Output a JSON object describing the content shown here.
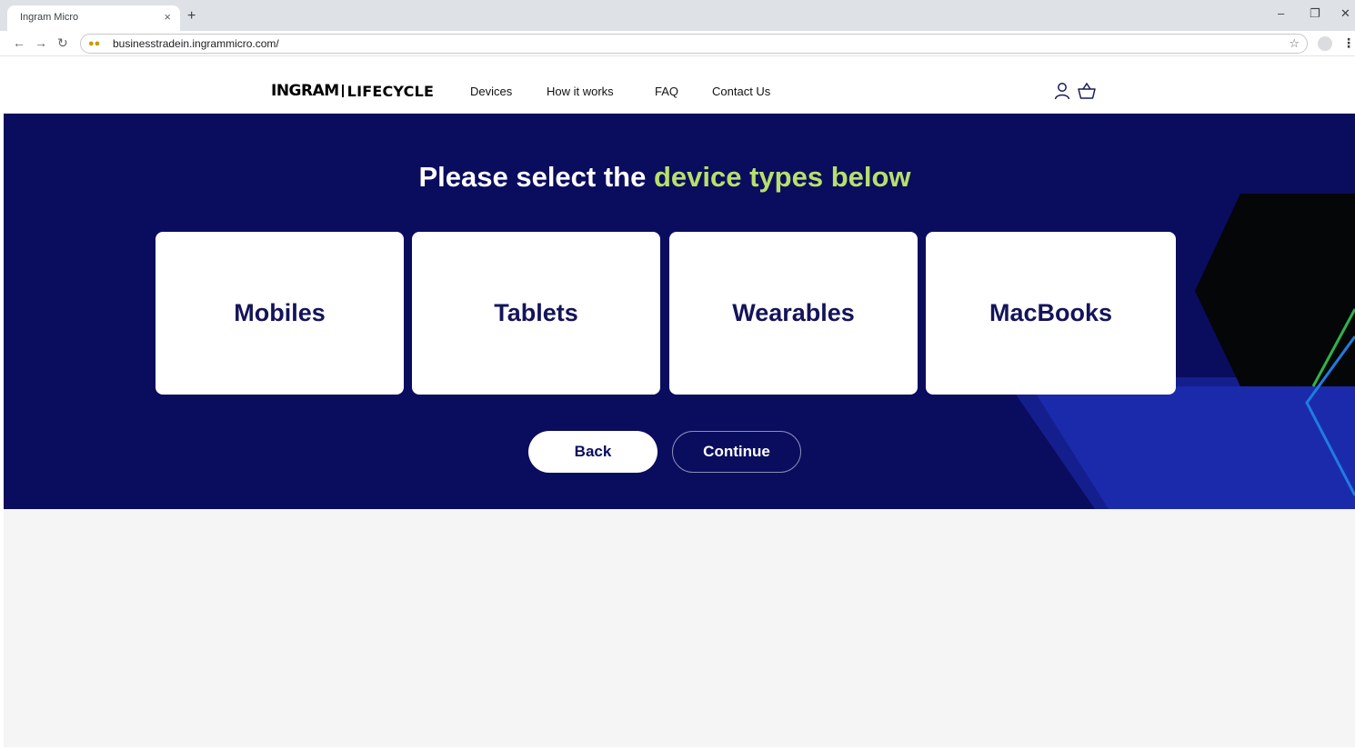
{
  "browser": {
    "tab_title": "Ingram Micro",
    "tab_close": "×",
    "new_tab": "+",
    "url": "businesstradein.ingrammicro.com/",
    "controls": {
      "minimize": "–",
      "restore": "❐",
      "close": "✕"
    }
  },
  "header": {
    "logo": {
      "brand": "INGRAM",
      "product": "LIFECYCLE"
    },
    "nav": [
      "Devices",
      "How it works",
      "FAQ",
      "Contact Us"
    ],
    "icons": [
      "user-icon",
      "basket-icon"
    ]
  },
  "hero": {
    "heading_prefix": "Please select the ",
    "heading_highlight": "device types below",
    "cards": [
      "Mobiles",
      "Tablets",
      "Wearables",
      "MacBooks"
    ],
    "back_label": "Back",
    "continue_label": "Continue"
  },
  "colors": {
    "hero_background": "#0a0c5e",
    "highlight": "#b7e06a",
    "card_text": "#14145a"
  }
}
